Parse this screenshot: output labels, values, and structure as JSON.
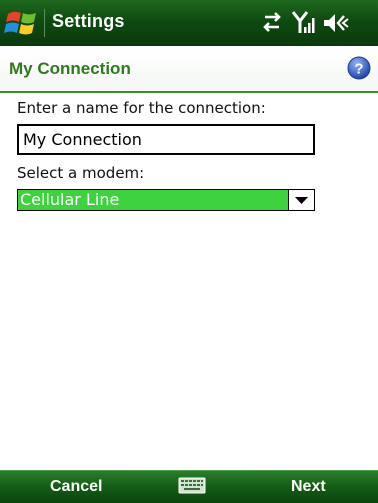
{
  "titlebar": {
    "title": "Settings",
    "icons": [
      "windows-start-icon",
      "data-connection-icon",
      "signal-strength-icon",
      "volume-icon"
    ]
  },
  "header": {
    "title": "My Connection",
    "help_icon": "help-icon"
  },
  "form": {
    "name_label": "Enter a name for the connection:",
    "name_value": "My Connection",
    "modem_label": "Select a modem:",
    "modem_value": "Cellular Line",
    "modem_options": [
      "Cellular Line"
    ]
  },
  "softbar": {
    "left_label": "Cancel",
    "right_label": "Next",
    "center_icon": "keyboard-icon"
  },
  "colors": {
    "titlebar_green": "#0f4a12",
    "accent_green": "#2f7a1e",
    "selection_green": "#3ed23e",
    "help_blue": "#2a54b8"
  }
}
